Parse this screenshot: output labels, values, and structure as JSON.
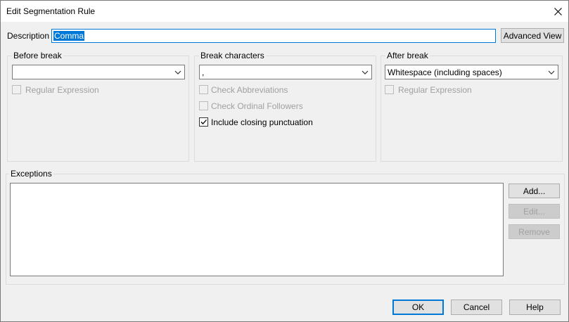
{
  "window": {
    "title": "Edit Segmentation Rule"
  },
  "description": {
    "label": "Description",
    "value": "Comma"
  },
  "advanced_view_label": "Advanced View",
  "before_break": {
    "title": "Before break",
    "value": "",
    "regex_label": "Regular Expression",
    "regex_checked": false
  },
  "break_characters": {
    "title": "Break characters",
    "value": ",",
    "check_abbreviations_label": "Check Abbreviations",
    "check_ordinal_label": "Check Ordinal Followers",
    "include_closing_label": "Include closing punctuation",
    "include_closing_checked": true
  },
  "after_break": {
    "title": "After break",
    "value": "Whitespace (including spaces)",
    "regex_label": "Regular Expression",
    "regex_checked": false
  },
  "exceptions": {
    "title": "Exceptions",
    "add_label": "Add...",
    "edit_label": "Edit...",
    "remove_label": "Remove"
  },
  "footer": {
    "ok_label": "OK",
    "cancel_label": "Cancel",
    "help_label": "Help"
  }
}
